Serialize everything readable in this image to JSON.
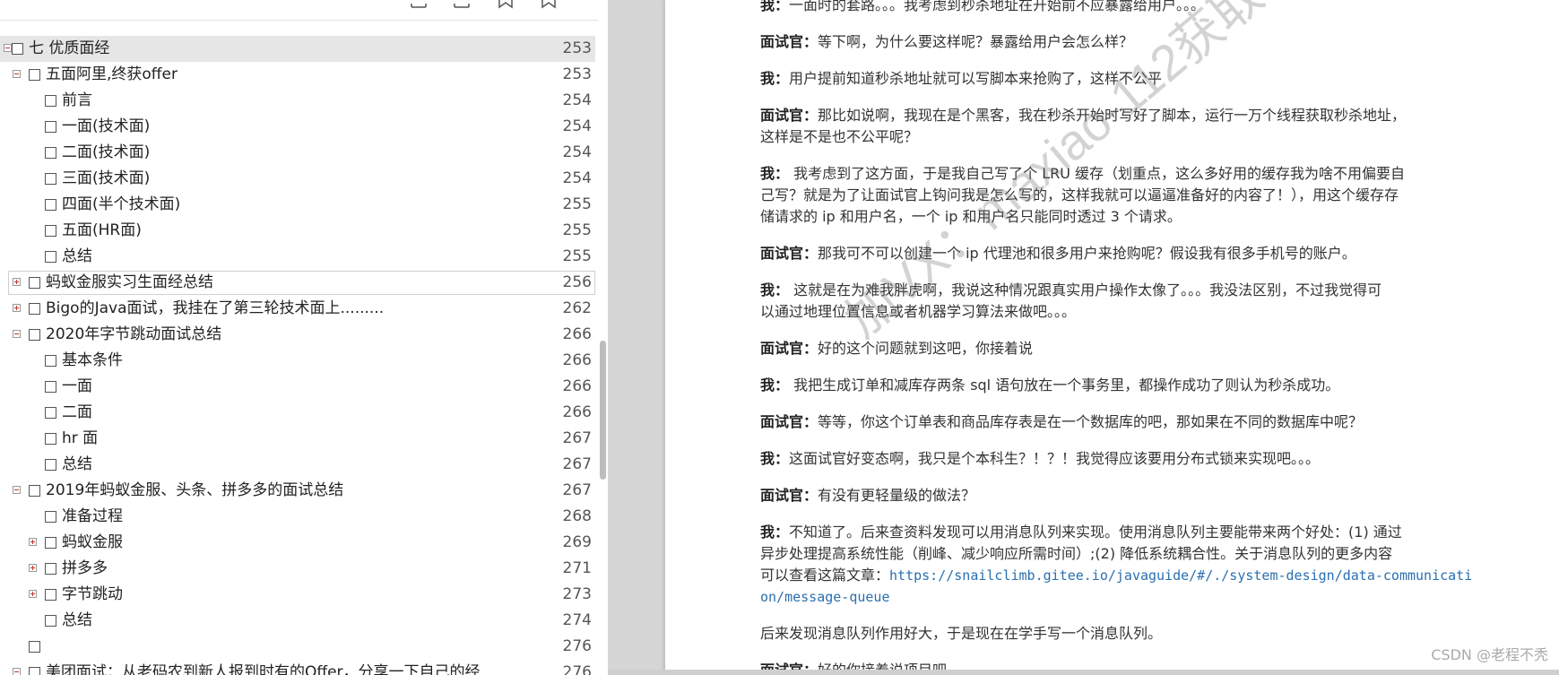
{
  "outline": {
    "rows": [
      {
        "level": 0,
        "toggle": "minus",
        "label": "七 优质面经",
        "page": "253",
        "selected": true
      },
      {
        "level": 1,
        "toggle": "minus",
        "label": "五面阿里,终获offer",
        "page": "253"
      },
      {
        "level": 2,
        "toggle": "none",
        "label": "前言",
        "page": "254"
      },
      {
        "level": 2,
        "toggle": "none",
        "label": "一面(技术面)",
        "page": "254"
      },
      {
        "level": 2,
        "toggle": "none",
        "label": "二面(技术面)",
        "page": "254"
      },
      {
        "level": 2,
        "toggle": "none",
        "label": "三面(技术面)",
        "page": "254"
      },
      {
        "level": 2,
        "toggle": "none",
        "label": "四面(半个技术面)",
        "page": "255"
      },
      {
        "level": 2,
        "toggle": "none",
        "label": "五面(HR面)",
        "page": "255"
      },
      {
        "level": 2,
        "toggle": "none",
        "label": "总结",
        "page": "255"
      },
      {
        "level": 1,
        "toggle": "plus",
        "label": "蚂蚁金服实习生面经总结",
        "page": "256",
        "hover": true
      },
      {
        "level": 1,
        "toggle": "plus",
        "label": "Bigo的Java面试，我挂在了第三轮技术面上.........",
        "page": "262"
      },
      {
        "level": 1,
        "toggle": "minus",
        "label": "2020年字节跳动面试总结",
        "page": "266"
      },
      {
        "level": 2,
        "toggle": "none",
        "label": "基本条件",
        "page": "266"
      },
      {
        "level": 2,
        "toggle": "none",
        "label": "一面",
        "page": "266"
      },
      {
        "level": 2,
        "toggle": "none",
        "label": "二面",
        "page": "266"
      },
      {
        "level": 2,
        "toggle": "none",
        "label": "hr 面",
        "page": "267"
      },
      {
        "level": 2,
        "toggle": "none",
        "label": "总结",
        "page": "267"
      },
      {
        "level": 1,
        "toggle": "minus",
        "label": "2019年蚂蚁金服、头条、拼多多的面试总结",
        "page": "267"
      },
      {
        "level": 2,
        "toggle": "none",
        "label": "准备过程",
        "page": "268"
      },
      {
        "level": 2,
        "toggle": "plus",
        "label": "蚂蚁金服",
        "page": "269"
      },
      {
        "level": 2,
        "toggle": "plus",
        "label": "拼多多",
        "page": "271"
      },
      {
        "level": 2,
        "toggle": "plus",
        "label": "字节跳动",
        "page": "273"
      },
      {
        "level": 2,
        "toggle": "none",
        "label": "总结",
        "page": "274"
      },
      {
        "level": 1,
        "toggle": "none",
        "label": "",
        "page": "276"
      },
      {
        "level": 1,
        "toggle": "minus",
        "label": "美团面试：从老码农到新人报到时有的Offer，分享一下自己的经",
        "page": "276"
      }
    ]
  },
  "document": {
    "paragraphs": [
      {
        "lines": [
          [
            {
              "t": "我：",
              "b": true
            },
            {
              "t": "一面时的套路。。。我考虑到秒杀地址在开始前不应暴露给用户。。。"
            }
          ]
        ]
      },
      {
        "lines": [
          [
            {
              "t": "面试官：",
              "b": true
            },
            {
              "t": "等下啊，为什么要这样呢？暴露给用户会怎么样？"
            }
          ]
        ]
      },
      {
        "lines": [
          [
            {
              "t": "我：",
              "b": true
            },
            {
              "t": "用户提前知道秒杀地址就可以写脚本来抢购了，这样不公平"
            }
          ]
        ]
      },
      {
        "lines": [
          [
            {
              "t": "面试官：",
              "b": true
            },
            {
              "t": "那比如说啊，我现在是个黑客，我在秒杀开始时写好了脚本，运行一万个线程获取秒杀地址，"
            }
          ],
          [
            {
              "t": "这样是不是也不公平呢？"
            }
          ]
        ]
      },
      {
        "lines": [
          [
            {
              "t": "我：",
              "b": true
            },
            {
              "t": "  我考虑到了这方面，于是我自己写了个 LRU 缓存（划重点，这么多好用的缓存我为啥不用偏要自"
            }
          ],
          [
            {
              "t": "己写？就是为了让面试官上钩问我是怎么写的，这样我就可以逼逼准备好的内容了！），用这个缓存存"
            }
          ],
          [
            {
              "t": "储请求的 ip 和用户名，一个 ip 和用户名只能同时透过 3 个请求。"
            }
          ]
        ]
      },
      {
        "lines": [
          [
            {
              "t": "面试官：",
              "b": true
            },
            {
              "t": "那我可不可以创建一个 ip 代理池和很多用户来抢购呢？假设我有很多手机号的账户。"
            }
          ]
        ]
      },
      {
        "lines": [
          [
            {
              "t": "我：",
              "b": true
            },
            {
              "t": "  这就是在为难我胖虎啊，我说这种情况跟真实用户操作太像了。。。我没法区别，不过我觉得可"
            }
          ],
          [
            {
              "t": "以通过地理位置信息或者机器学习算法来做吧。。。"
            }
          ]
        ]
      },
      {
        "lines": [
          [
            {
              "t": "面试官：",
              "b": true
            },
            {
              "t": "好的这个问题就到这吧，你接着说"
            }
          ]
        ]
      },
      {
        "lines": [
          [
            {
              "t": "我：",
              "b": true
            },
            {
              "t": "  我把生成订单和减库存两条 sql 语句放在一个事务里，都操作成功了则认为秒杀成功。"
            }
          ]
        ]
      },
      {
        "lines": [
          [
            {
              "t": "面试官：",
              "b": true
            },
            {
              "t": "等等，你这个订单表和商品库存表是在一个数据库的吧，那如果在不同的数据库中呢？"
            }
          ]
        ]
      },
      {
        "lines": [
          [
            {
              "t": "我：",
              "b": true
            },
            {
              "t": "这面试官好变态啊，我只是个本科生？！？！我觉得应该要用分布式锁来实现吧。。。"
            }
          ]
        ]
      },
      {
        "lines": [
          [
            {
              "t": "面试官：",
              "b": true
            },
            {
              "t": "有没有更轻量级的做法？"
            }
          ]
        ]
      },
      {
        "lines": [
          [
            {
              "t": "我：",
              "b": true
            },
            {
              "t": "不知道了。后来查资料发现可以用消息队列来实现。使用消息队列主要能带来两个好处：(1) 通过"
            }
          ],
          [
            {
              "t": "异步处理提高系统性能（削峰、减少响应所需时间）;(2) 降低系统耦合性。关于消息队列的更多内容"
            }
          ],
          [
            {
              "t": "可以查看这篇文章："
            },
            {
              "t": "https://snailclimb.gitee.io/javaguide/#/./system-design/data-communicati",
              "link": true
            }
          ],
          [
            {
              "t": "on/message-queue",
              "link": true
            }
          ]
        ]
      },
      {
        "lines": [
          [
            {
              "t": "后来发现消息队列作用好大，于是现在在学手写一个消息队列。"
            }
          ]
        ]
      },
      {
        "lines": [
          [
            {
              "t": "面试官：",
              "b": true
            },
            {
              "t": "好的你接着说项目吧。"
            }
          ]
        ]
      }
    ],
    "watermark": "加VX：maxiao-112获取",
    "credit": "CSDN @老程不秃"
  }
}
